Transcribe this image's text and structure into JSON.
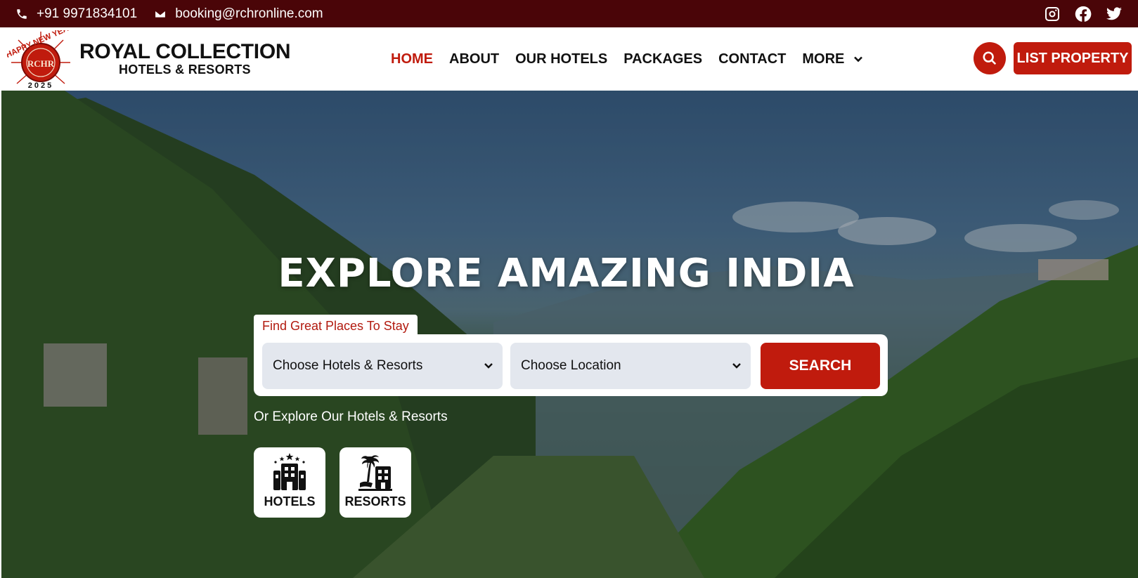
{
  "topbar": {
    "phone": "+91 9971834101",
    "email": "booking@rchronline.com",
    "social_icons": [
      "instagram-icon",
      "facebook-icon",
      "twitter-icon"
    ]
  },
  "brand": {
    "badge_top_text": "HAPPY NEW YEAR",
    "badge_monogram": "RCHR",
    "badge_year": "2025",
    "name": "ROYAL COLLECTION",
    "tagline": "HOTELS & RESORTS"
  },
  "nav": {
    "items": [
      {
        "label": "HOME",
        "active": true
      },
      {
        "label": "ABOUT",
        "active": false
      },
      {
        "label": "OUR HOTELS",
        "active": false
      },
      {
        "label": "PACKAGES",
        "active": false
      },
      {
        "label": "CONTACT",
        "active": false
      },
      {
        "label": "MORE",
        "active": false
      }
    ],
    "list_property_label": "LIST PROPERTY"
  },
  "hero": {
    "title": "EXPLORE AMAZING INDIA",
    "tab_label": "Find Great Places To Stay",
    "type_select": "Choose Hotels & Resorts",
    "location_select": "Choose Location",
    "search_label": "SEARCH",
    "explore_text": "Or Explore Our Hotels & Resorts",
    "categories": [
      {
        "label": "HOTELS",
        "icon": "hotel-building-icon"
      },
      {
        "label": "RESORTS",
        "icon": "resort-palm-icon"
      }
    ]
  },
  "colors": {
    "topbar_bg": "#4a0508",
    "accent": "#c01b0d",
    "select_bg": "#e3e7ee"
  }
}
